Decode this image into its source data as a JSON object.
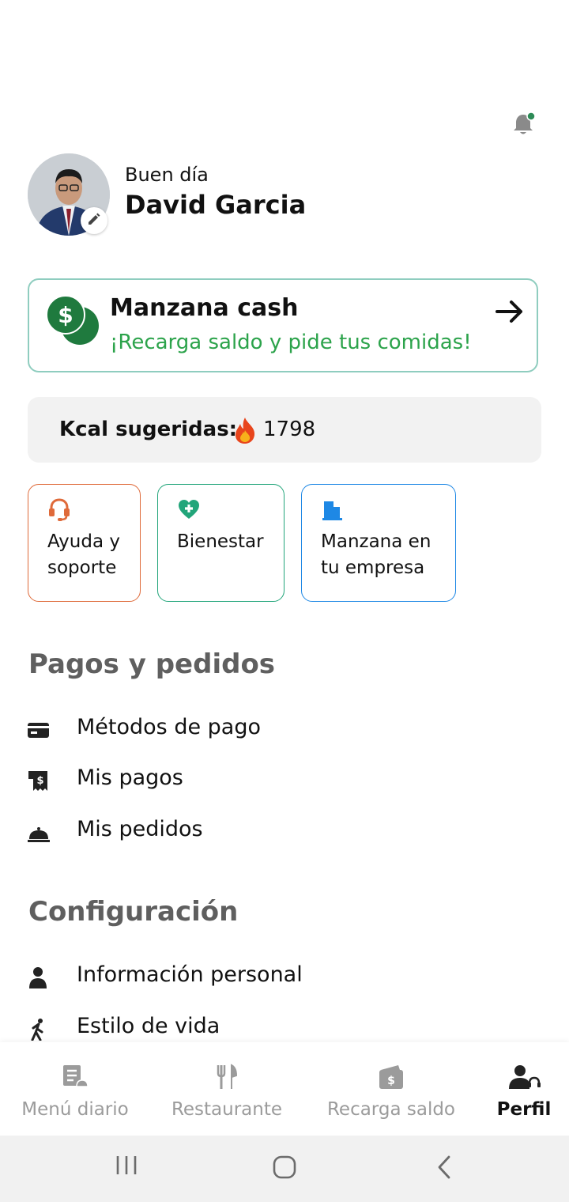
{
  "header": {
    "greeting": "Buen día",
    "user_name": "David Garcia",
    "notification_dot_color": "#2e8b57"
  },
  "cash_card": {
    "title": "Manzana cash",
    "subtitle": "¡Recarga saldo y pide tus comidas!",
    "accent_color": "#2ca34b"
  },
  "kcal": {
    "label": "Kcal sugeridas:",
    "value": "1798"
  },
  "shortcuts": [
    {
      "label_line1": "Ayuda y",
      "label_line2": "soporte",
      "icon": "headset-icon",
      "color": "#df6a3a"
    },
    {
      "label_line1": "Bienestar",
      "label_line2": "",
      "icon": "heart-plus-icon",
      "color": "#22a57a"
    },
    {
      "label_line1": "Manzana en",
      "label_line2": "tu empresa",
      "icon": "building-icon",
      "color": "#1e88e5"
    }
  ],
  "payments_section": {
    "title": "Pagos y pedidos",
    "items": [
      {
        "label": "Métodos de pago",
        "icon": "credit-card-icon"
      },
      {
        "label": "Mis pagos",
        "icon": "receipt-icon"
      },
      {
        "label": "Mis pedidos",
        "icon": "cloche-icon"
      }
    ]
  },
  "settings_section": {
    "title": "Configuración",
    "items": [
      {
        "label": "Información personal",
        "icon": "person-icon"
      },
      {
        "label": "Estilo de vida",
        "icon": "walking-icon"
      }
    ]
  },
  "bottom_nav": {
    "items": [
      {
        "label": "Menú diario",
        "icon": "menu-list-icon",
        "active": false
      },
      {
        "label": "Restaurante",
        "icon": "fork-knife-icon",
        "active": false
      },
      {
        "label": "Recarga saldo",
        "icon": "wallet-icon",
        "active": false
      },
      {
        "label": "Perfil",
        "icon": "profile-support-icon",
        "active": true
      }
    ]
  }
}
